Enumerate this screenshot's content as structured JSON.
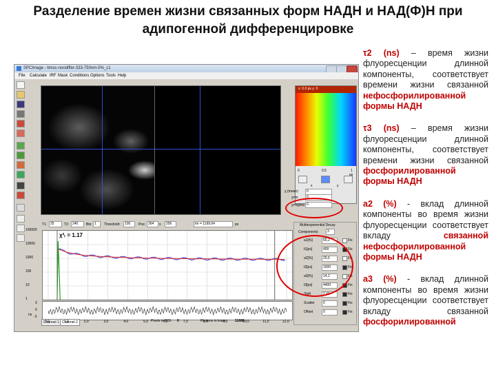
{
  "slide": {
    "title": "Разделение времен жизни связанных форм НАДН и НАД(Ф)Н при адипогенной дифференцировке"
  },
  "notes": [
    {
      "sym": "τ2",
      "unit": "(ns)",
      "text": " – время жизни флуоресценции длинной компоненты, соответствует времени жизни связанной ",
      "highlight": "нефосфорилированной формы НАДН",
      "tail": ""
    },
    {
      "sym": "τ3",
      "unit": "(ns)",
      "text": " – время жизни флуоресценции длинной компоненты, соответствует времени жизни связанной ",
      "highlight": "фосфорилированной формы НАДН",
      "tail": ""
    },
    {
      "sym": "a2",
      "unit": "(%)",
      "text": " - вклад длинной компоненты во время жизни флуоресценции соответствует вкладу ",
      "highlight": "связанной нефосфорилированной формы НАДН",
      "tail": ""
    },
    {
      "sym": "a3",
      "unit": "(%)",
      "text": "  - вклад длинной компоненты во время жизни флуоресценции соответствует вкладу связанной ",
      "highlight": "",
      "tail": "фосфорилированной"
    }
  ],
  "app": {
    "window_title": "SPCImage - bmsc-nondiffer-333-750nm-5%_c1",
    "menu": [
      "File",
      "Calculate",
      "IRF",
      "Mask",
      "Conditions",
      "Options",
      "Tools",
      "Help"
    ],
    "toolbar_icons": [
      "document-icon",
      "folder-open-icon",
      "save-icon",
      "print-icon",
      "lock-icon",
      "unlock-icon",
      "arrow-icon",
      "arrow-icon",
      "palette-icon",
      "palette-icon",
      "image-icon",
      "image-icon",
      "glasses-icon",
      "zoom-in-icon",
      "zoom-out-icon",
      "hand-icon"
    ],
    "colorbar": {
      "header": "x: 0.0  ps     y:  0",
      "ticks": [
        "0",
        "0,5",
        "1"
      ],
      "unit": "ps",
      "axis_labels": [
        "x",
        "y"
      ],
      "stats": [
        {
          "label": "χ (mean)",
          "value": "0"
        },
        {
          "label": "χ=m",
          "value": "0"
        },
        {
          "label": "χ=sigma",
          "value": "0"
        }
      ]
    },
    "params": {
      "T1_label": "T1:",
      "T1": "25",
      "T2_label": "T2:",
      "T2": "240",
      "bin_label": "Bin:",
      "bin": "1",
      "threshold_label": "Threshold:",
      "threshold": "100",
      "pos_label": "Pos:",
      "pos_x": "264",
      "pos_x_suffix": "x",
      "pos_y": "256",
      "tm_label": "tm = 1199,64",
      "tm_unit": "ps"
    },
    "decay_plot": {
      "chi_text": "χ²ᵣ = 1.17",
      "y_ticks": [
        "100000",
        "10000",
        "1000",
        "100",
        "10",
        "1"
      ],
      "x_ticks": [
        "0,0",
        "1,0",
        "2,0",
        "3,0",
        "4,0",
        "5,0",
        "6,0",
        "7,0",
        "8,0",
        "9,0",
        "10,0",
        "11,0",
        "12,0"
      ],
      "x_unit": "ns",
      "resid_ticks": [
        "3",
        "0",
        "-3"
      ]
    },
    "footer": {
      "tab1": "Channel 1",
      "tab2": "Channel 2",
      "pixels_label": "Pixels in ROI:",
      "pixels_value": "0",
      "photons_label": "Photons in trace:",
      "photons_value": "11686"
    },
    "fit": {
      "title": "Multiexponential Decay",
      "components_label": "Components:",
      "components": "3",
      "fix_label": "Fix",
      "rows": [
        {
          "label": "a1[%]",
          "value": "65,2",
          "fix": false
        },
        {
          "label": "t1[ps]",
          "value": "409",
          "fix": true
        },
        {
          "label": "a2[%]",
          "value": "20,6",
          "fix": false
        },
        {
          "label": "t2[ps]",
          "value": "1500",
          "fix": true
        },
        {
          "label": "a3[%]",
          "value": "14,2",
          "fix": false
        },
        {
          "label": "t3[ps]",
          "value": "4400",
          "fix": true
        },
        {
          "label": "Shift",
          "value": "2,40",
          "fix": true
        },
        {
          "label": "Scatter",
          "value": "0",
          "fix": true
        },
        {
          "label": "Offset",
          "value": "0",
          "fix": true
        }
      ]
    }
  }
}
